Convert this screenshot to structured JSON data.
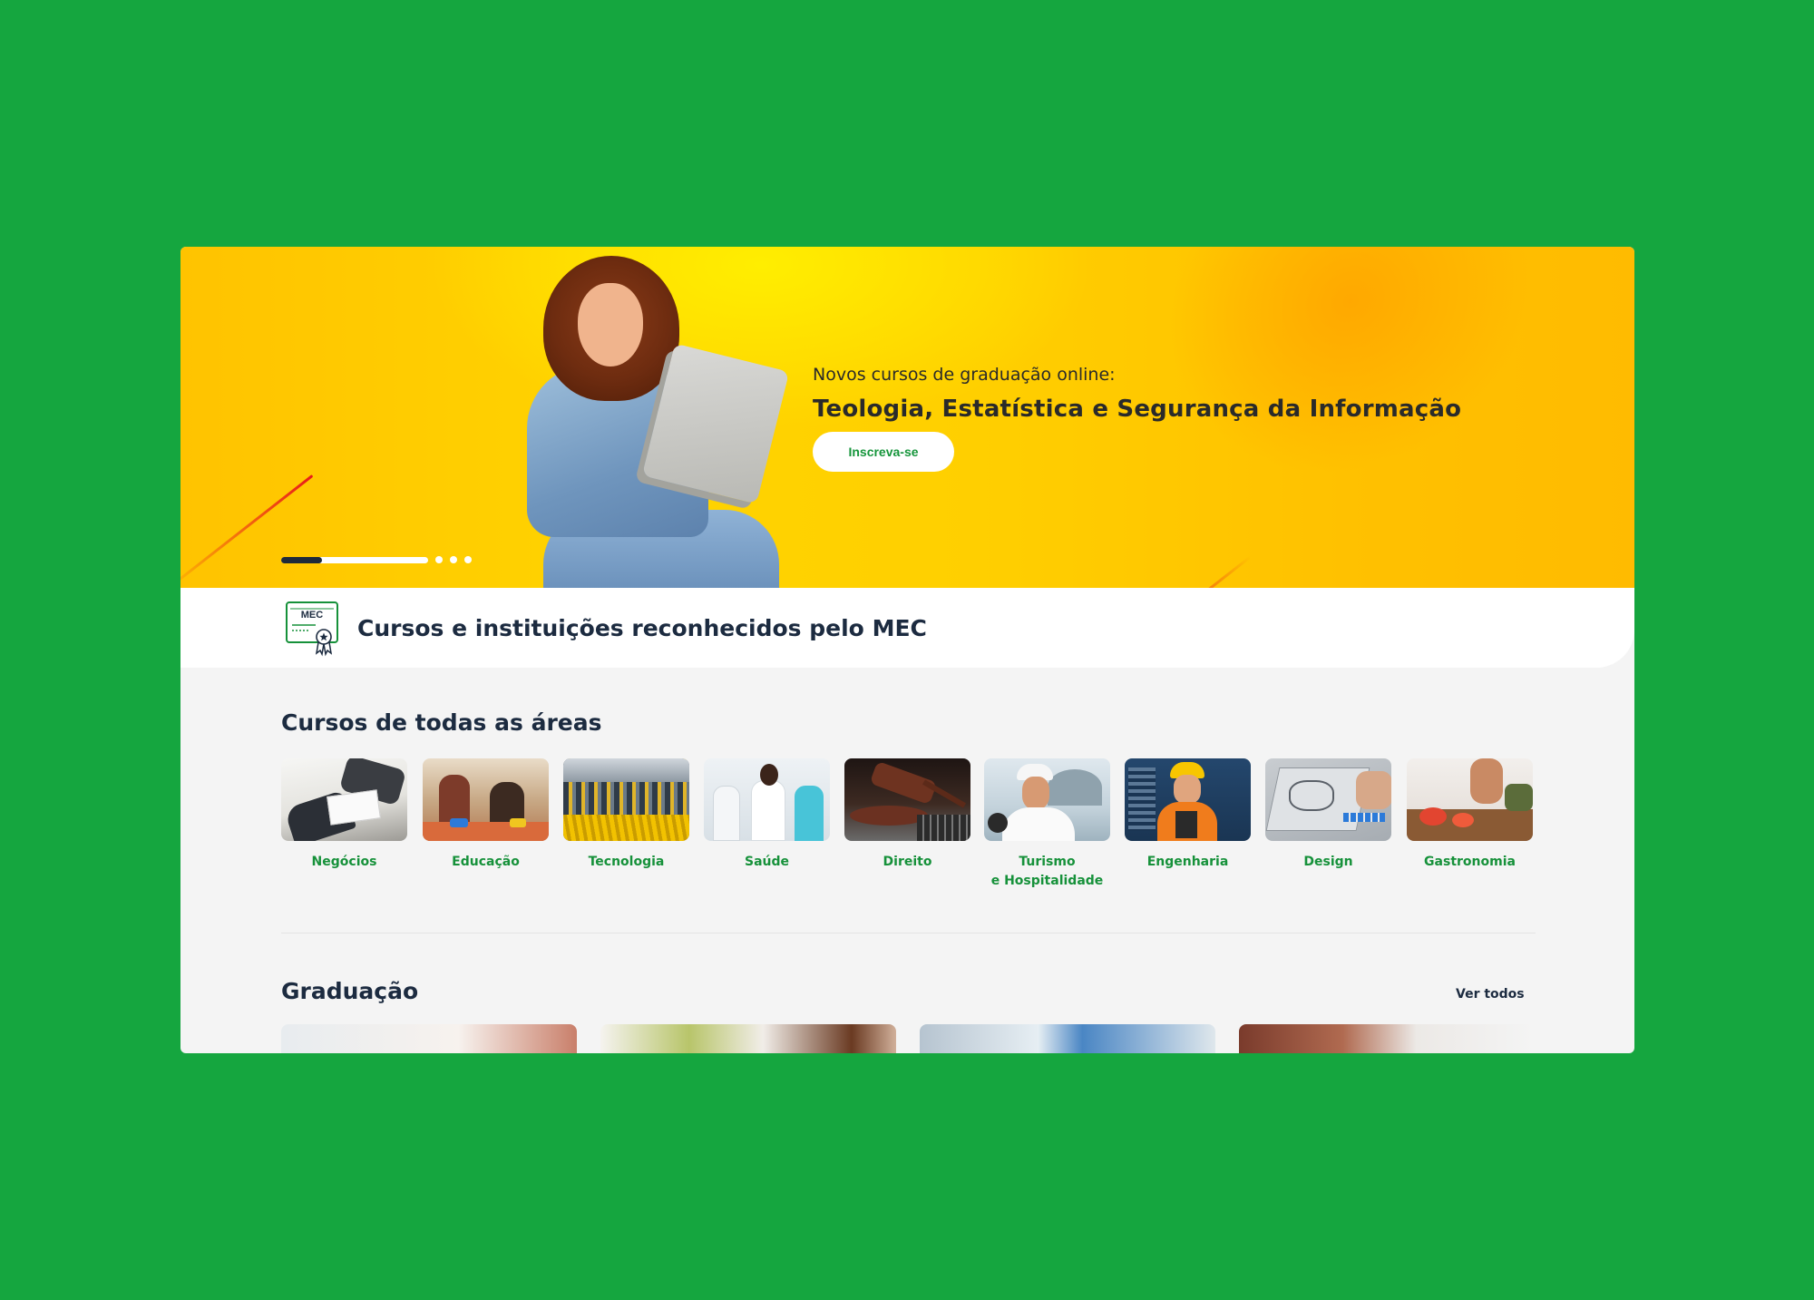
{
  "hero": {
    "subtitle": "Novos cursos de graduação online:",
    "title": "Teologia, Estatística e Segurança da Informação",
    "cta": "Inscreva-se",
    "slides": 4,
    "active_slide": 1
  },
  "mec": {
    "badge": "MEC",
    "title": "Cursos e instituições reconhecidos pelo MEC"
  },
  "areas": {
    "title": "Cursos de todas as áreas",
    "items": [
      {
        "label": "Negócios",
        "icon": "business-photo"
      },
      {
        "label": "Educação",
        "icon": "education-photo"
      },
      {
        "label": "Tecnologia",
        "icon": "technology-photo"
      },
      {
        "label": "Saúde",
        "icon": "health-photo"
      },
      {
        "label": "Direito",
        "icon": "law-photo"
      },
      {
        "label": "Turismo\ne Hospitalidade",
        "icon": "tourism-photo"
      },
      {
        "label": "Engenharia",
        "icon": "engineering-photo"
      },
      {
        "label": "Design",
        "icon": "design-photo"
      },
      {
        "label": "Gastronomia",
        "icon": "gastronomy-photo"
      }
    ]
  },
  "graduacao": {
    "title": "Graduação",
    "see_all": "Ver todos"
  },
  "colors": {
    "background": "#15a63f",
    "accent_green": "#16913a",
    "heading_navy": "#1c2b40",
    "hero_yellow": "#ffc800"
  }
}
